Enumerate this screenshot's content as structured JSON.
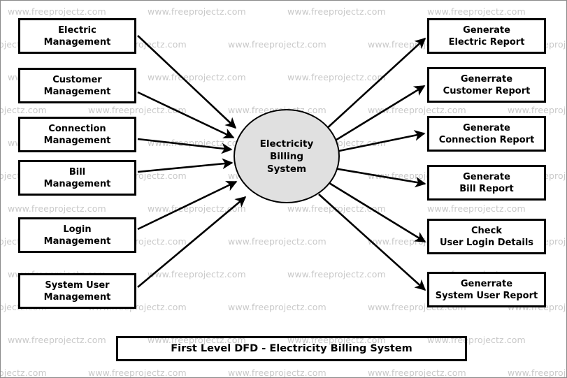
{
  "diagram": {
    "title": "First Level DFD - Electricity Billing System",
    "caption": "First Level DFD - Electricity Billing System",
    "process": {
      "label": "Electricity\nBilling\nSystem",
      "fill": "#e0e0e0",
      "stroke": "#000000"
    },
    "input_entities": [
      {
        "label": "Electric\nManagement"
      },
      {
        "label": "Customer\nManagement"
      },
      {
        "label": "Connection\nManagement"
      },
      {
        "label": "Bill\nManagement"
      },
      {
        "label": "Login\nManagement"
      },
      {
        "label": "System User\nManagement"
      }
    ],
    "output_entities": [
      {
        "label": "Generate\nElectric Report"
      },
      {
        "label": "Generrate\nCustomer Report"
      },
      {
        "label": "Generate\nConnection Report"
      },
      {
        "label": "Generate\nBill Report"
      },
      {
        "label": "Check\nUser Login Details"
      },
      {
        "label": "Generrate\nSystem User Report"
      }
    ],
    "colors": {
      "border": "#000000",
      "background": "#ffffff",
      "watermark": "#c9c9c9",
      "process_fill": "#e0e0e0"
    }
  },
  "watermark": {
    "text": "www.freeprojectz.com"
  }
}
